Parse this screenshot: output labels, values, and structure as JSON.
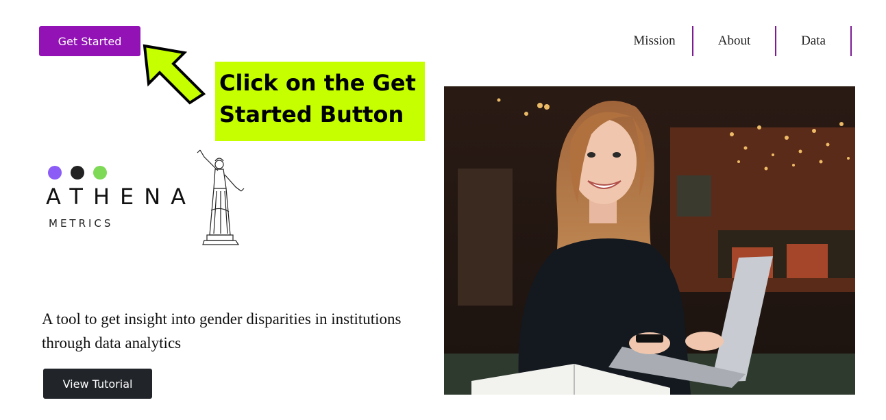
{
  "header": {
    "cta_label": "Get Started",
    "nav": [
      {
        "label": "Mission"
      },
      {
        "label": "About"
      },
      {
        "label": "Data"
      }
    ]
  },
  "annotation": {
    "line1": "Click on the Get",
    "line2": "Started Button",
    "arrow_icon": "arrow-up-left-icon",
    "highlight_color": "#c6ff00",
    "arrow_color": "#c6ff00"
  },
  "logo": {
    "wordmark": "ATHENA",
    "subtitle": "METRICS",
    "dot_colors": [
      "#8b5cf6",
      "#222222",
      "#7ed957"
    ],
    "illustration": "athena-statue-icon"
  },
  "main": {
    "tagline": "A tool to get insight into gender disparities in institutions through data analytics",
    "tutorial_label": "View Tutorial"
  },
  "hero": {
    "image": "woman-with-laptop-photo"
  },
  "colors": {
    "primary": "#9212b5",
    "dark_button": "#212529",
    "nav_divider": "#7d1a94"
  }
}
